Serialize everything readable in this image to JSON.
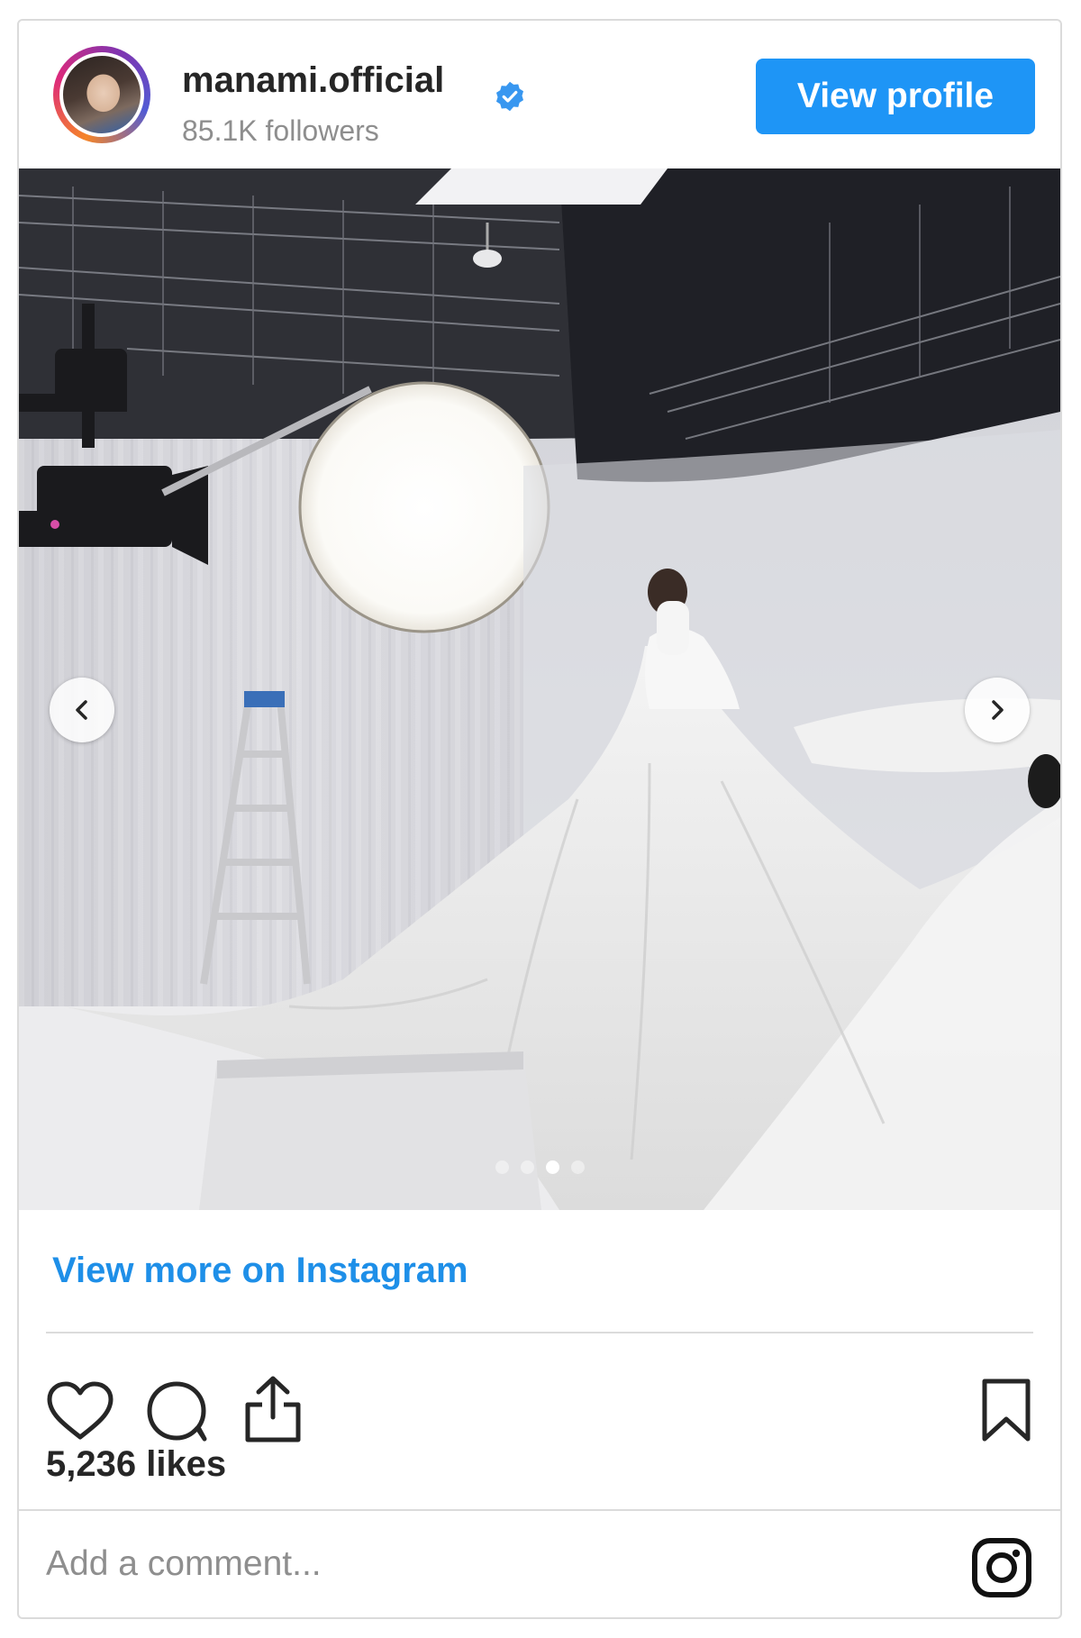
{
  "header": {
    "username": "manami.official",
    "followers": "85.1K followers",
    "view_profile_label": "View profile",
    "verified": true,
    "verified_color": "#3897f0"
  },
  "carousel": {
    "slide_count": 4,
    "active_slide": 3
  },
  "links": {
    "view_more": "View more on Instagram"
  },
  "actions": {
    "icons": [
      "heart-icon",
      "comment-icon",
      "share-icon",
      "bookmark-icon"
    ]
  },
  "post": {
    "likes": "5,236 likes"
  },
  "comment": {
    "placeholder": "Add a comment..."
  },
  "colors": {
    "accent": "#1e95f6",
    "link": "#1e8fe8",
    "text": "#262626",
    "muted": "#8e8e8e",
    "border": "#dbdbdb"
  }
}
